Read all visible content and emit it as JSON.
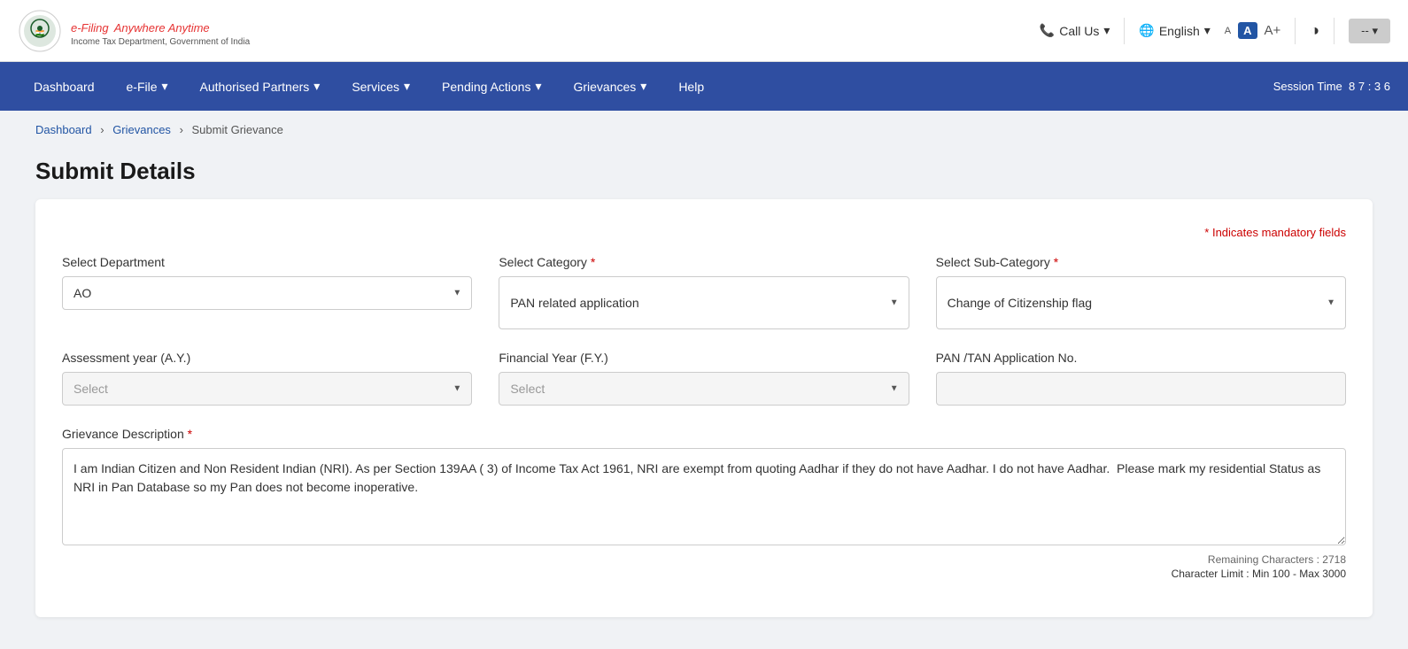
{
  "header": {
    "logo_title": "e-Filing",
    "logo_tagline": "Anywhere Anytime",
    "logo_subtitle": "Income Tax Department, Government of India",
    "call_us": "Call Us",
    "language": "English",
    "font_small": "A",
    "font_medium": "A",
    "font_large": "A+",
    "contrast_icon": "◑",
    "user_btn": "--",
    "user_dropdown": "▾"
  },
  "navbar": {
    "items": [
      {
        "label": "Dashboard",
        "has_dropdown": false
      },
      {
        "label": "e-File",
        "has_dropdown": true
      },
      {
        "label": "Authorised Partners",
        "has_dropdown": true
      },
      {
        "label": "Services",
        "has_dropdown": true
      },
      {
        "label": "Pending Actions",
        "has_dropdown": true
      },
      {
        "label": "Grievances",
        "has_dropdown": true
      },
      {
        "label": "Help",
        "has_dropdown": false
      }
    ],
    "session_label": "Session Time",
    "session_value": "8 7 : 3 6"
  },
  "breadcrumb": {
    "items": [
      "Dashboard",
      "Grievances",
      "Submit Grievance"
    ]
  },
  "form": {
    "title": "Submit Details",
    "mandatory_note": "* Indicates mandatory fields",
    "select_department_label": "Select Department",
    "select_department_value": "AO",
    "select_category_label": "Select Category",
    "select_category_required": "*",
    "select_category_value": "PAN related application",
    "select_subcategory_label": "Select Sub-Category",
    "select_subcategory_required": "*",
    "select_subcategory_value": "Change of Citizenship flag",
    "assessment_year_label": "Assessment year (A.Y.)",
    "assessment_year_placeholder": "Select",
    "financial_year_label": "Financial Year (F.Y.)",
    "financial_year_placeholder": "Select",
    "pan_tan_label": "PAN /TAN Application No.",
    "pan_tan_value": "",
    "grievance_desc_label": "Grievance Description",
    "grievance_desc_required": "*",
    "grievance_desc_value": "I am Indian Citizen and Non Resident Indian (NRI). As per Section 139AA ( 3) of Income Tax Act 1961, NRI are exempt from quoting Aadhar if they do not have Aadhar. I do not have Aadhar.  Please mark my residential Status as NRI in Pan Database so my Pan does not become inoperative.",
    "remaining_chars_label": "Remaining Characters : 2718",
    "char_limit_label": "Character Limit : Min 100 - Max 3000"
  }
}
